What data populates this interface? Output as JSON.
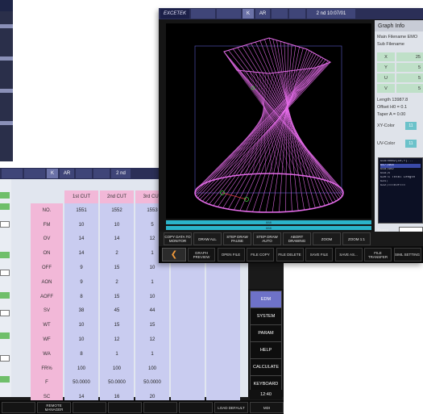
{
  "colors": {
    "titlebar": "#2b2f57",
    "param_label": "#f2b8d8",
    "param_value": "#c9ccf0",
    "wire": "#e36be8",
    "progress": "#2bb3c9",
    "info_green": "#bfe0c8",
    "active_menu": "#6e72c8",
    "arrow": "#f29a3a"
  },
  "back_window": {
    "titlebar": [
      "",
      "",
      "K",
      "AR",
      "",
      "",
      "2 nd"
    ],
    "columns": [
      "1st CUT",
      "2nd CUT",
      "3rd CUT"
    ],
    "rows": [
      {
        "label": "NO.",
        "values": [
          "1551",
          "1552",
          "1553"
        ]
      },
      {
        "label": "FM",
        "values": [
          "10",
          "10",
          "5"
        ]
      },
      {
        "label": "OV",
        "values": [
          "14",
          "14",
          "12"
        ]
      },
      {
        "label": "ON",
        "values": [
          "14",
          "2",
          "1"
        ]
      },
      {
        "label": "OFF",
        "values": [
          "9",
          "15",
          "10"
        ]
      },
      {
        "label": "AON",
        "values": [
          "9",
          "2",
          "1"
        ]
      },
      {
        "label": "AOFF",
        "values": [
          "8",
          "15",
          "10"
        ]
      },
      {
        "label": "SV",
        "values": [
          "38",
          "45",
          "44"
        ]
      },
      {
        "label": "WT",
        "values": [
          "10",
          "15",
          "15"
        ]
      },
      {
        "label": "WF",
        "values": [
          "10",
          "12",
          "12"
        ]
      },
      {
        "label": "WA",
        "values": [
          "8",
          "1",
          "1"
        ]
      },
      {
        "label": "FR%",
        "values": [
          "100",
          "100",
          "100"
        ]
      },
      {
        "label": "F",
        "values": [
          "50.0000",
          "50.0000",
          "50.0000"
        ]
      },
      {
        "label": "SC",
        "values": [
          "14",
          "16",
          "20"
        ]
      },
      {
        "label": "OFFSET",
        "values": [
          "0.2180",
          "0.1530",
          "0.1410"
        ]
      }
    ],
    "menu": [
      {
        "label": "EDM",
        "active": true
      },
      {
        "label": "SYSTEM",
        "active": false
      },
      {
        "label": "PARAM",
        "active": false
      },
      {
        "label": "HELP",
        "active": false
      },
      {
        "label": "CALCULATE",
        "active": false
      },
      {
        "label": "KEYBOARD",
        "active": false
      }
    ],
    "clock": "12:40",
    "fn_buttons": [
      "",
      "REMOTE MANAGER",
      "",
      "",
      "",
      "",
      "LOAD DEFAULT",
      "MDI"
    ]
  },
  "front_window": {
    "logo": "EXCETEK",
    "titlebar": [
      "",
      "",
      "K",
      "AR",
      "",
      "",
      "2 nd 10:07/01"
    ],
    "info": {
      "title": "Graph Info",
      "main_filename": "Main Filename  EMO",
      "sub_filename": "Sub Filename",
      "axes": [
        {
          "axis": "X",
          "value": "25"
        },
        {
          "axis": "Y",
          "value": "5"
        },
        {
          "axis": "U",
          "value": "5"
        },
        {
          "axis": "V",
          "value": "5"
        }
      ],
      "length": "Length    13987.8",
      "offset": "Offset    H0 = 0.1",
      "taper": "Taper     A = 0.00",
      "xy_color_label": "XY-Color",
      "uv_color_label": "UV-Color",
      "xy_color_value": "11",
      "uv_color_value": "11",
      "code_lines": [
        "G16=0082(10,Y)...",
        "G17;G54",
        "G18;G02",
        "G19;X",
        "G20:1 Total Length",
        "G21;",
        "G22;===EOF==="
      ],
      "code_selected": 1,
      "steps_label": "Steps"
    },
    "progress_labels": [
      "888",
      "888"
    ],
    "action_buttons": [
      "COPY DATA TO MONITOR",
      "DRAW ALL",
      "STEP DRAW PAUSE",
      "STEP DRAW AUTO",
      "ABORT DRAWING",
      "ZOOM",
      "ZOOM 1:1"
    ],
    "fn_buttons": [
      "GRAPH PREVIEW",
      "OPEN FILE",
      "FILE COPY",
      "FILE DELETE",
      "SAVE FILE",
      "SAVE AS...",
      "FILE TRANSFER",
      "SIML SETTING"
    ]
  }
}
